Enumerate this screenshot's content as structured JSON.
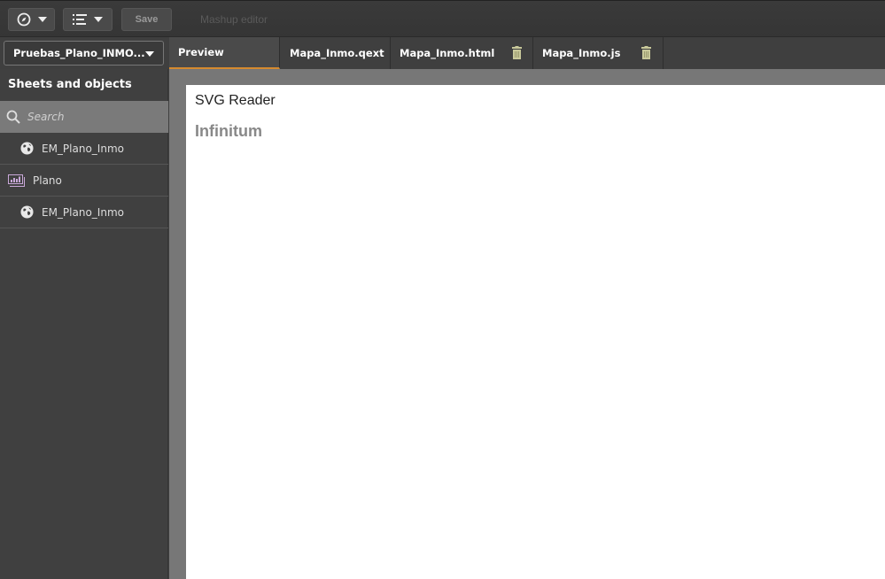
{
  "toolbar": {
    "nav_icon": "compass-icon",
    "list_icon": "list-icon",
    "save_label": "Save",
    "title": "Mashup editor"
  },
  "app_selector": {
    "value": "Pruebas_Plano_INMO..."
  },
  "tabs": [
    {
      "label": "Preview",
      "active": true,
      "deletable": false
    },
    {
      "label": "Mapa_Inmo.qext",
      "active": false,
      "deletable": false
    },
    {
      "label": "Mapa_Inmo.html",
      "active": false,
      "deletable": true
    },
    {
      "label": "Mapa_Inmo.js",
      "active": false,
      "deletable": true
    }
  ],
  "sidebar": {
    "title": "Sheets and objects",
    "search_placeholder": "Search",
    "items": [
      {
        "label": "EM_Plano_Inmo",
        "icon": "globe-icon",
        "level": 1
      },
      {
        "label": "Plano",
        "icon": "sheet-icon",
        "level": 0
      },
      {
        "label": "EM_Plano_Inmo",
        "icon": "globe-icon",
        "level": 1
      }
    ]
  },
  "preview": {
    "title": "SVG Reader",
    "subtitle": "Infinitum"
  },
  "colors": {
    "accent": "#d68a2e",
    "trash": "#c8c89a",
    "sheet_icon": "#c9a8d9"
  }
}
